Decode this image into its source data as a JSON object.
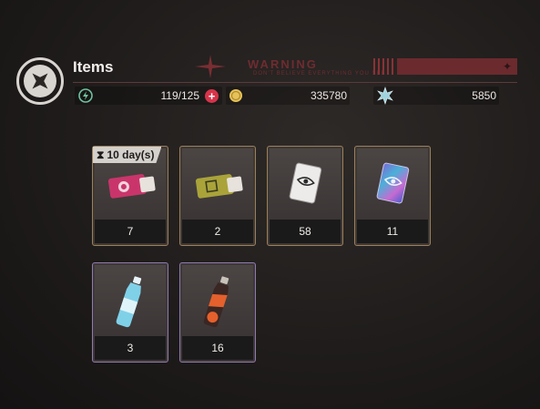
{
  "header": {
    "title": "Items",
    "warning_title": "WARNING",
    "warning_subtitle": "DON'T BELIEVE EVERYTHING YOU SEE"
  },
  "stats": {
    "stamina": "119/125",
    "coins": "335780",
    "crystals": "5850"
  },
  "items": [
    {
      "icon": "pink-ticket-icon",
      "count": "7",
      "badge": "10 day(s)"
    },
    {
      "icon": "gold-ticket-icon",
      "count": "2"
    },
    {
      "icon": "white-card-icon",
      "count": "58"
    },
    {
      "icon": "holo-card-icon",
      "count": "11"
    },
    {
      "icon": "blue-drink-icon",
      "count": "3"
    },
    {
      "icon": "orange-drink-icon",
      "count": "16"
    }
  ],
  "colors": {
    "accent_red": "#6b2a2e",
    "gold_border": "#9c8058",
    "purple_border": "#8f7ab3"
  }
}
